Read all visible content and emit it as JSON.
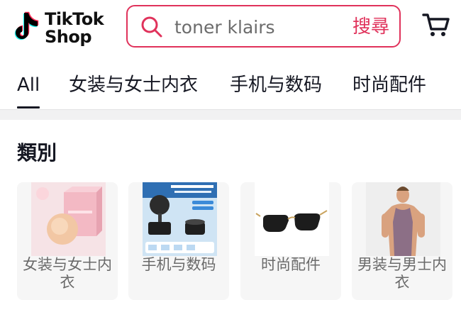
{
  "header": {
    "logo": {
      "line1": "TikTok",
      "line2": "Shop",
      "icon": "tiktok-note-icon"
    },
    "search": {
      "placeholder": "toner klairs",
      "button_label": "搜尋",
      "icon": "search-icon",
      "border_color": "#e0325b"
    },
    "cart_icon": "shopping-cart-icon"
  },
  "tabs": [
    {
      "label": "All",
      "active": true
    },
    {
      "label": "女装与女士内衣",
      "active": false
    },
    {
      "label": "手机与数码",
      "active": false
    },
    {
      "label": "时尚配件",
      "active": false
    }
  ],
  "categories_section": {
    "title": "類別",
    "items": [
      {
        "label": "女装与女士内衣",
        "image": "silicone-bra-pads-with-pink-box"
      },
      {
        "label": "手机与数码",
        "image": "vacuum-suction-cup-magnetic-phone-bracket"
      },
      {
        "label": "时尚配件",
        "image": "black-sunglasses"
      },
      {
        "label": "男装与男士内衣",
        "image": "man-in-purple-tank-top"
      }
    ]
  },
  "colors": {
    "accent": "#e0325b",
    "text": "#161823",
    "muted_text": "#6a6a6a",
    "card_bg": "#f6f6f6"
  }
}
